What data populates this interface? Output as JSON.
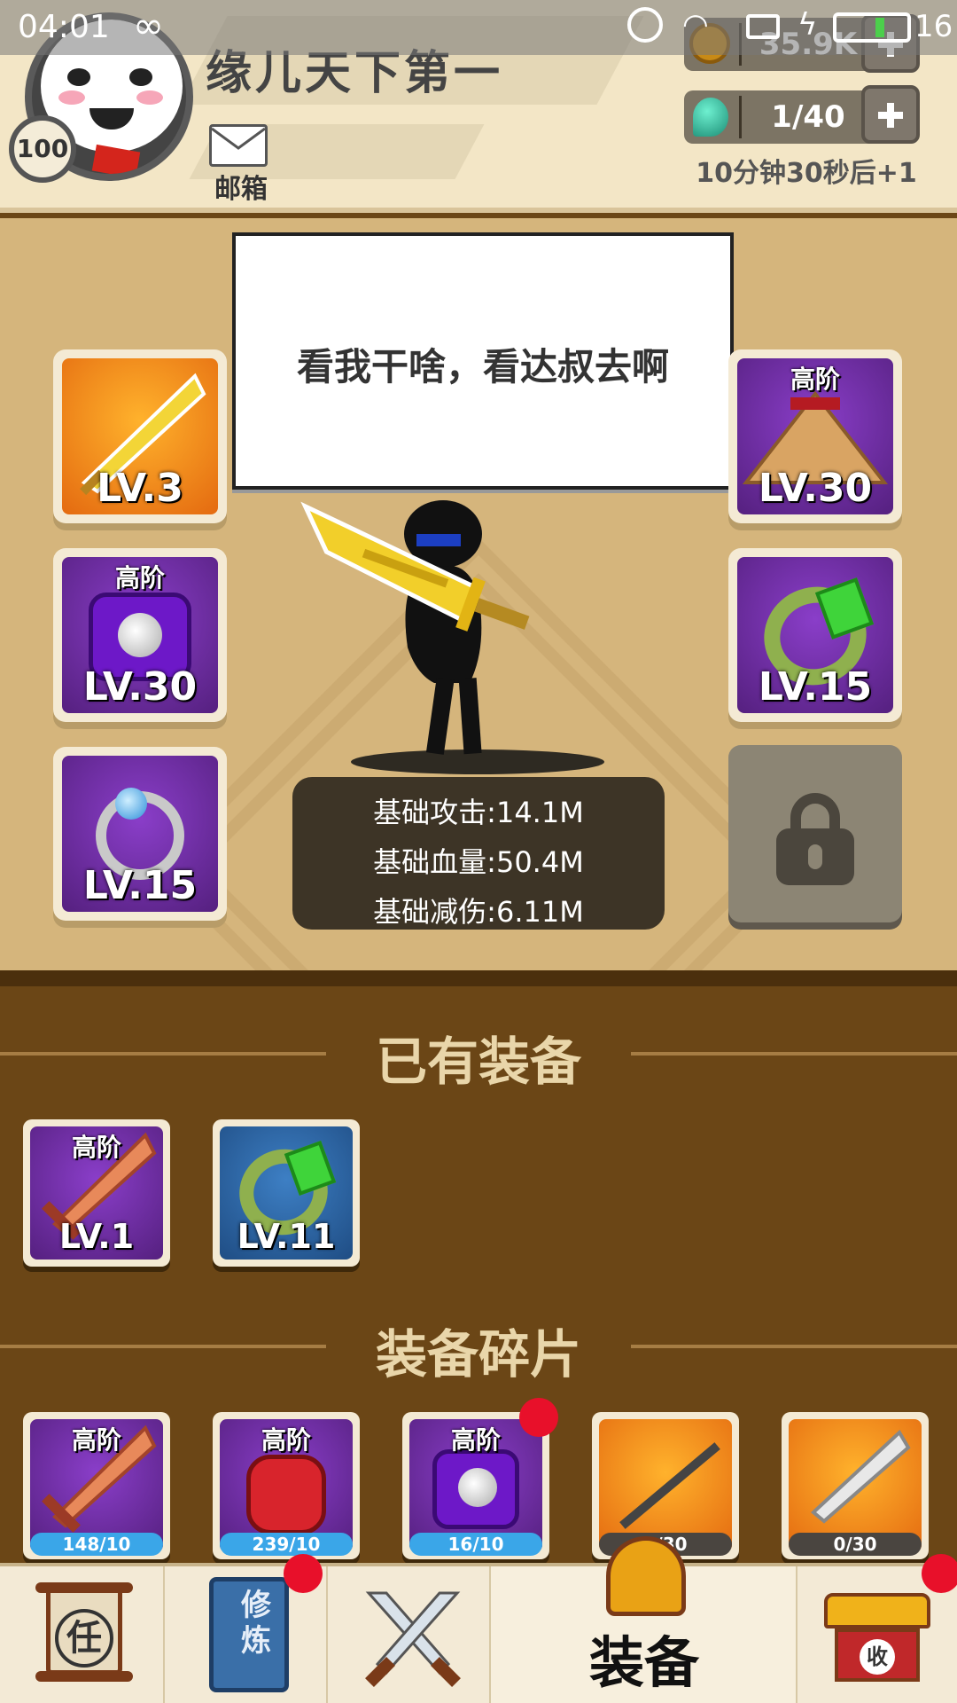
{
  "status": {
    "time": "04:01",
    "battery": "16"
  },
  "header": {
    "player_name": "缘儿天下第一",
    "level": "100",
    "mail_label": "邮箱",
    "gold": "35.9K",
    "energy": "1/40",
    "energy_timer": "10分钟30秒后+1"
  },
  "speech": "看我干啥，看达叔去啊",
  "equipped": {
    "weapon": {
      "level": "LV.3",
      "tier": ""
    },
    "hat": {
      "level": "LV.30",
      "tier": "高阶"
    },
    "armor": {
      "level": "LV.30",
      "tier": "高阶"
    },
    "bracelet": {
      "level": "LV.15",
      "tier": ""
    },
    "ring": {
      "level": "LV.15",
      "tier": ""
    }
  },
  "stats": {
    "attack": "基础攻击:14.1M",
    "hp": "基础血量:50.4M",
    "defense": "基础减伤:6.11M"
  },
  "owned": {
    "title": "已有装备",
    "items": [
      {
        "tier": "高阶",
        "level": "LV.1"
      },
      {
        "tier": "",
        "level": "LV.11"
      }
    ]
  },
  "fragments": {
    "title": "装备碎片",
    "items": [
      {
        "tier": "高阶",
        "progress": "148/10"
      },
      {
        "tier": "高阶",
        "progress": "239/10"
      },
      {
        "tier": "高阶",
        "progress": "16/10"
      },
      {
        "tier": "",
        "progress": "0/30"
      },
      {
        "tier": "",
        "progress": "0/30"
      }
    ]
  },
  "nav": {
    "task_char": "任",
    "train_label": "修炼",
    "equip_label": "装备",
    "collect_char": "收"
  }
}
